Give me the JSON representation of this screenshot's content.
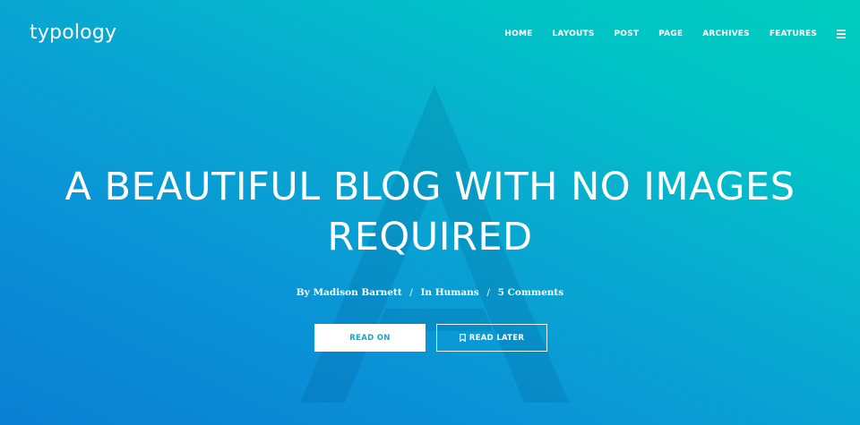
{
  "site": {
    "logo": "typology"
  },
  "nav": {
    "items": [
      {
        "label": "HOME"
      },
      {
        "label": "LAYOUTS"
      },
      {
        "label": "POST"
      },
      {
        "label": "PAGE"
      },
      {
        "label": "ARCHIVES"
      },
      {
        "label": "FEATURES"
      }
    ],
    "menu_icon": "hamburger-menu-icon"
  },
  "hero": {
    "title": "A BEAUTIFUL BLOG WITH NO IMAGES REQUIRED",
    "meta": {
      "by_prefix": "By",
      "author": "Madison Barnett",
      "separator": "/",
      "category_prefix": "In",
      "category": "Humans",
      "comments": "5 Comments"
    },
    "buttons": {
      "read_on": "READ ON",
      "read_later": "READ LATER",
      "read_later_icon": "bookmark-icon"
    }
  },
  "colors": {
    "gradient_start": "#0a7fd2",
    "gradient_end": "#00cdbf",
    "text": "#ffffff",
    "button_text_accent": "#18a9c9"
  }
}
